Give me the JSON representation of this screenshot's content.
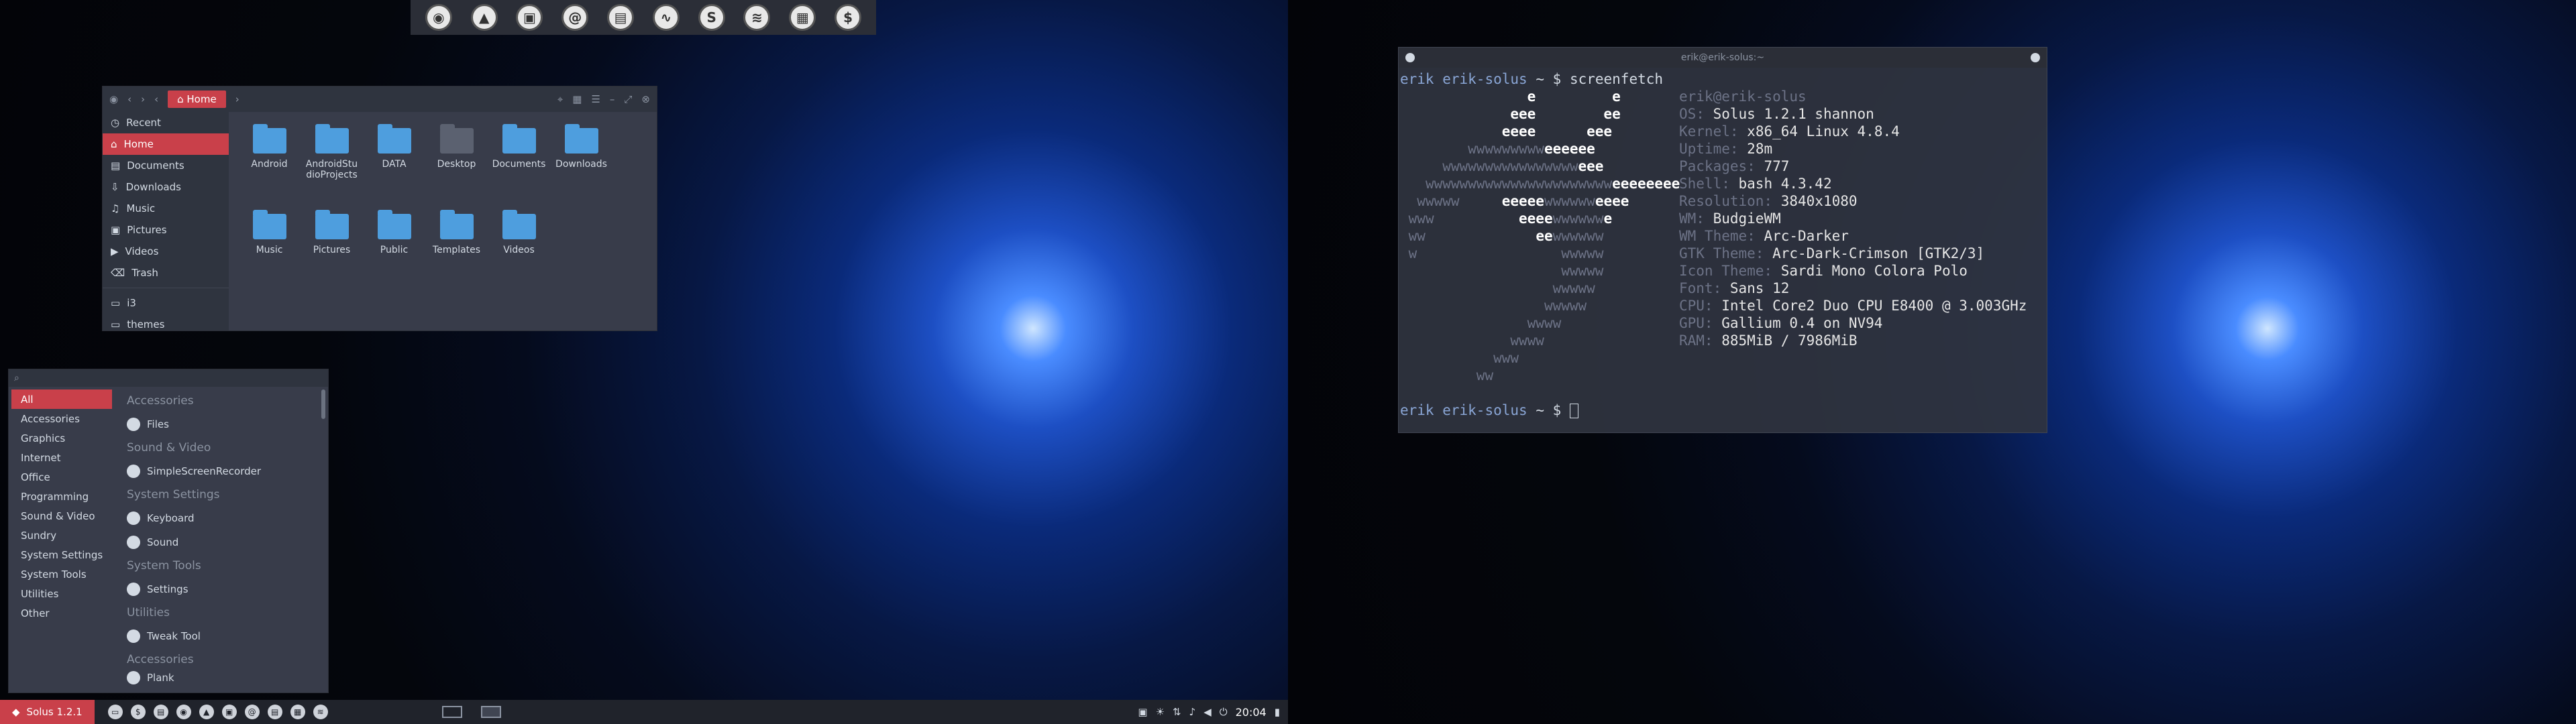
{
  "dock": {
    "icons": [
      "firefox-icon",
      "vlc-icon",
      "image-viewer-icon",
      "at-icon",
      "office-icon",
      "activity-icon",
      "skype-icon",
      "spotify-icon",
      "chrome-app-icon",
      "terminal-icon"
    ]
  },
  "file_manager": {
    "breadcrumb": "Home",
    "sidebar": [
      "Recent",
      "Home",
      "Documents",
      "Downloads",
      "Music",
      "Pictures",
      "Videos",
      "Trash",
      "i3",
      "themes"
    ],
    "files": [
      "Android",
      "AndroidStudioProjects",
      "DATA",
      "Desktop",
      "Documents",
      "Downloads",
      "Music",
      "Pictures",
      "Public",
      "Templates",
      "Videos"
    ]
  },
  "menu": {
    "categories": [
      "All",
      "Accessories",
      "Graphics",
      "Internet",
      "Office",
      "Programming",
      "Sound & Video",
      "Sundry",
      "System Settings",
      "System Tools",
      "Utilities",
      "Other"
    ],
    "sections": [
      {
        "title": "Accessories",
        "apps": [
          "Files"
        ]
      },
      {
        "title": "Sound & Video",
        "apps": [
          "SimpleScreenRecorder"
        ]
      },
      {
        "title": "System Settings",
        "apps": [
          "Keyboard",
          "Sound"
        ]
      },
      {
        "title": "System Tools",
        "apps": [
          "Settings"
        ]
      },
      {
        "title": "Utilities",
        "apps": [
          "Tweak Tool"
        ]
      },
      {
        "title": "Accessories",
        "apps": [
          "Plank"
        ]
      }
    ]
  },
  "panel": {
    "menu_label": "Solus 1.2.1",
    "clock": "20:04"
  },
  "terminal": {
    "title": "erik@erik-solus:~",
    "prompt_user": "erik",
    "prompt_host": "erik-solus",
    "prompt_dir": "~",
    "prompt_symbol": "$",
    "command": "screenfetch",
    "header": "erik@erik-solus",
    "info": [
      {
        "k": "OS:",
        "v": "Solus 1.2.1 shannon"
      },
      {
        "k": "Kernel:",
        "v": "x86_64 Linux 4.8.4"
      },
      {
        "k": "Uptime:",
        "v": "28m"
      },
      {
        "k": "Packages:",
        "v": "777"
      },
      {
        "k": "Shell:",
        "v": "bash 4.3.42"
      },
      {
        "k": "Resolution:",
        "v": "3840x1080"
      },
      {
        "k": "WM:",
        "v": "BudgieWM"
      },
      {
        "k": "WM Theme:",
        "v": "Arc-Darker"
      },
      {
        "k": "GTK Theme:",
        "v": "Arc-Dark-Crimson [GTK2/3]"
      },
      {
        "k": "Icon Theme:",
        "v": "Sardi Mono Colora Polo"
      },
      {
        "k": "Font:",
        "v": "Sans 12"
      },
      {
        "k": "CPU:",
        "v": "Intel Core2 Duo CPU E8400 @ 3.003GHz"
      },
      {
        "k": "GPU:",
        "v": "Gallium 0.4 on NV94"
      },
      {
        "k": "RAM:",
        "v": "885MiB / 7986MiB"
      }
    ]
  },
  "colors": {
    "accent": "#c9404a",
    "panel": "#20232b",
    "window": "#383c4a"
  }
}
